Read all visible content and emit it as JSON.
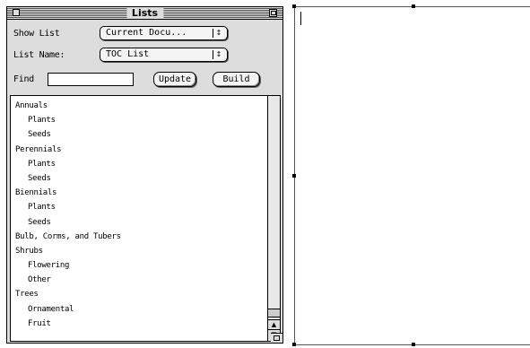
{
  "palette": {
    "title": "Lists",
    "show_list_label": "Show List",
    "show_list_value": "Current Docu...",
    "list_name_label": "List Name:",
    "list_name_value": "TOC List",
    "find_label": "Find",
    "find_value": "",
    "update_label": "Update",
    "build_label": "Build",
    "items": [
      {
        "text": "Annuals",
        "level": 0
      },
      {
        "text": "Plants",
        "level": 1
      },
      {
        "text": "Seeds",
        "level": 1
      },
      {
        "text": "Perennials",
        "level": 0
      },
      {
        "text": "Plants",
        "level": 1
      },
      {
        "text": "Seeds",
        "level": 1
      },
      {
        "text": "Biennials",
        "level": 0
      },
      {
        "text": "Plants",
        "level": 1
      },
      {
        "text": "Seeds",
        "level": 1
      },
      {
        "text": "Bulb, Corms, and Tubers",
        "level": 0
      },
      {
        "text": "Shrubs",
        "level": 0
      },
      {
        "text": "Flowering",
        "level": 1
      },
      {
        "text": "Other",
        "level": 1
      },
      {
        "text": "Trees",
        "level": 0
      },
      {
        "text": "Ornamental",
        "level": 1
      },
      {
        "text": "Fruit",
        "level": 1
      }
    ]
  },
  "icons": {
    "close": "close-box-icon",
    "zoom": "zoom-box-icon",
    "popup_arrow": "updown-arrow-icon",
    "scroll_up": "arrow-up-icon",
    "scroll_down": "arrow-down-icon",
    "grow": "size-box-icon"
  },
  "colors": {
    "window_bg": "#dddddd",
    "list_bg": "#ffffff",
    "border": "#000000"
  }
}
